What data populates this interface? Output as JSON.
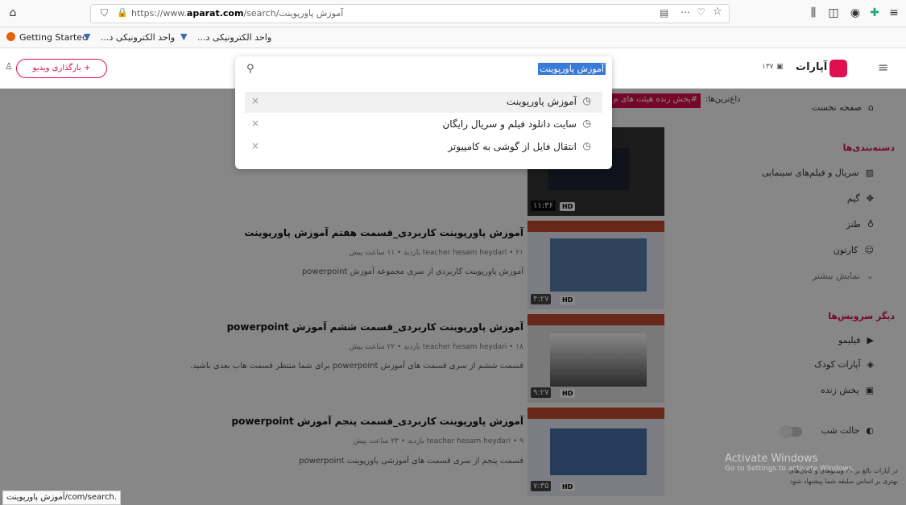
{
  "browser": {
    "url_prefix": "https://www.",
    "url_domain": "aparat.com",
    "url_path": "/search/آموزش پاورپوینت",
    "bookmarks": [
      "Getting Started",
      "واحد الکترونیکی د...",
      "واحد الکترونیکی د..."
    ],
    "status_link": "آموزش پاورپوینت/com/search."
  },
  "header": {
    "logo_text": "آپارات",
    "notif_count": "۱۳۷",
    "upload_button": "+ بارگذاری ویدیو",
    "search_query": "آموزش پاورپوینت"
  },
  "search_dropdown": {
    "suggestions": [
      "آموزش پاورپوینت",
      "سایت دانلود فیلم و سریال رایگان",
      "انتقال فایل از گوشی به کامپیوتر"
    ],
    "remove_glyph": "×"
  },
  "sidebar": {
    "home": "صفحه نخست",
    "categories_title": "دسته‌بندی‌ها",
    "categories": [
      "سریال و فیلم‌های سینمایی",
      "گیم",
      "طنز",
      "کارتون"
    ],
    "show_more": "نمایش بیشتر",
    "services_title": "دیگر سرویس‌ها",
    "services": [
      "فیلیمو",
      "آپارات کودک",
      "پخش زنده"
    ],
    "dark_mode": "حالت شب",
    "footer_note": "در آپارات بالغ بر ۲۱ ویدیوهای و کانال‌های بهتری بر اساس سلیقه شما پیشنهاد شود"
  },
  "trending": {
    "label": "داغ‌ترین‌ها:",
    "tag": "#پخش زنده هیئت های م"
  },
  "videos": [
    {
      "title": "آموزش پاورپوینت کاربردی_قسمت هفتم آموزش پاورپوینت",
      "meta": "teacher hesam heydari • ۲۱ بازدید • ۱۱ ساعت پیش",
      "desc": "آموزش پاورپوینت کاربردی از سری مجموعه آموزش powerpoint",
      "duration": "۴:۲۷",
      "hd": "HD"
    },
    {
      "title": "آموزش پاورپوینت کاربردی_قسمت ششم آموزش powerpoint",
      "meta": "teacher hesam heydari • ۱۸ بازدید • ۲۲ ساعت پیش",
      "desc": "قسمت ششم از سری قسمت های آموزش powerpoint برای شما منتظر قسمت هاب بعدی باشید.",
      "duration": "۹:۲۷",
      "hd": "HD"
    },
    {
      "title": "آموزش پاورپوینت کاربردی_قسمت پنجم آموزش powerpoint",
      "meta": "teacher hesam heydari • ۹ بازدید • ۲۳ ساعت پیش",
      "desc": "قسمت پنجم از سری قسمت های آموزشی پاورپوینت powerpoint",
      "duration": "۷:۳۵",
      "hd": "HD"
    }
  ],
  "first_thumb": {
    "duration": "۱۱:۳۶",
    "hd": "HD"
  },
  "watermark": {
    "line1": "Activate Windows",
    "line2": "Go to Settings to activate Windows."
  },
  "colors": {
    "brand": "#df0f50",
    "highlight": "#3b7bd8"
  }
}
